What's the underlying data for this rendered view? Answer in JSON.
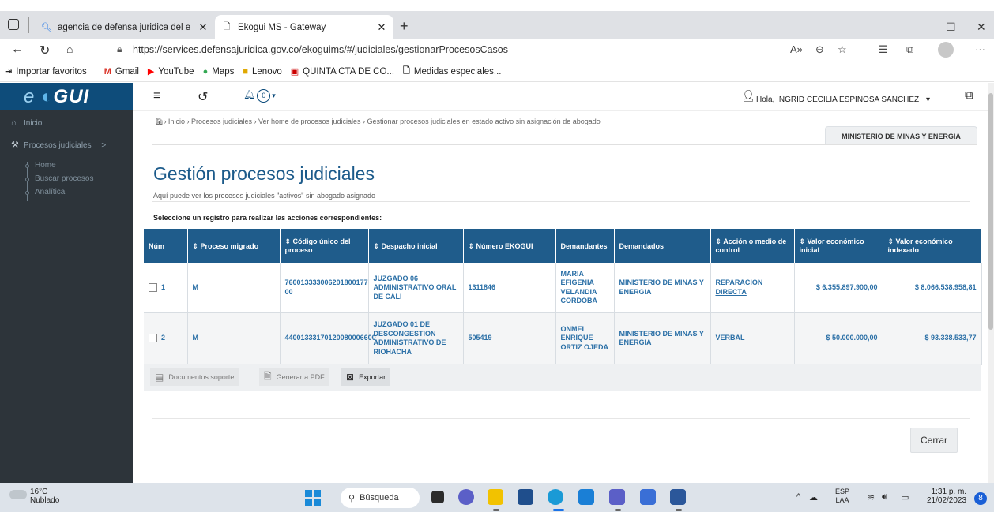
{
  "browser": {
    "tabs": [
      {
        "label": "agencia de defensa juridica del e",
        "icon": "search-icon"
      },
      {
        "label": "Ekogui MS - Gateway",
        "icon": "page-icon"
      }
    ],
    "url": "https://services.defensajuridica.gov.co/ekoguims/#/judiciales/gestionarProcesosCasos",
    "favorites": [
      "Importar favoritos",
      "Gmail",
      "YouTube",
      "Maps",
      "Lenovo",
      "QUINTA CTA DE CO...",
      "Medidas especiales..."
    ]
  },
  "app": {
    "logo": "eKOGUI",
    "sidebar": {
      "items": [
        {
          "label": "Inicio",
          "icon": "home-icon"
        },
        {
          "label": "Procesos judiciales",
          "icon": "gavel-icon",
          "chevron": ">"
        }
      ],
      "sub_items": [
        "Home",
        "Buscar procesos",
        "Analítica"
      ]
    },
    "header": {
      "notifications": "0",
      "user": "Hola, INGRID CECILIA ESPINOSA SANCHEZ"
    },
    "breadcrumb": "› Inicio › Procesos judiciales › Ver home de procesos judiciales › Gestionar procesos judiciales en estado activo sin asignación de abogado",
    "entity_tab": "MINISTERIO DE MINAS Y ENERGIA",
    "title": "Gestión procesos judiciales",
    "subtitle": "Aquí puede ver los procesos judiciales \"activos\" sin abogado asignado",
    "instruction": "Seleccione un registro para realizar las acciones correspondientes:",
    "table": {
      "headers": [
        "Núm",
        "⇕ Proceso migrado",
        "⇕ Código único del proceso",
        "⇕ Despacho inicial",
        "⇕ Número EKOGUI",
        "Demandantes",
        "Demandados",
        "⇕ Acción o medio de control",
        "⇕ Valor económico inicial",
        "⇕ Valor económico indexado"
      ],
      "rows": [
        {
          "num": "1",
          "migrado": "M",
          "codigo": "760013333006201800177 00",
          "despacho": "JUZGADO 06 ADMINISTRATIVO ORAL DE CALI",
          "ekogui": "1311846",
          "demandantes": "MARIA EFIGENIA VELANDIA CORDOBA",
          "demandados": "MINISTERIO DE MINAS Y ENERGIA",
          "accion": "REPARACION DIRECTA",
          "valor_inicial": "$ 6.355.897.900,00",
          "valor_indexado": "$ 8.066.538.958,81"
        },
        {
          "num": "2",
          "migrado": "M",
          "codigo": "44001333170120080006600",
          "despacho": "JUZGADO 01 DE DESCONGESTION ADMINISTRATIVO DE RIOHACHA",
          "ekogui": "505419",
          "demandantes": "ONMEL ENRIQUE ORTIZ OJEDA",
          "demandados": "MINISTERIO DE MINAS Y ENERGIA",
          "accion": "VERBAL",
          "valor_inicial": "$ 50.000.000,00",
          "valor_indexado": "$ 93.338.533,77"
        }
      ]
    },
    "actions": {
      "docs": "Documentos soporte",
      "pdf": "Generar a PDF",
      "export": "Exportar"
    },
    "close": "Cerrar"
  },
  "taskbar": {
    "temp": "16°C",
    "weather": "Nublado",
    "search": "Búsqueda",
    "lang1": "ESP",
    "lang2": "LAA",
    "time": "1:31 p. m.",
    "date": "21/02/2023",
    "notifications": "8"
  }
}
